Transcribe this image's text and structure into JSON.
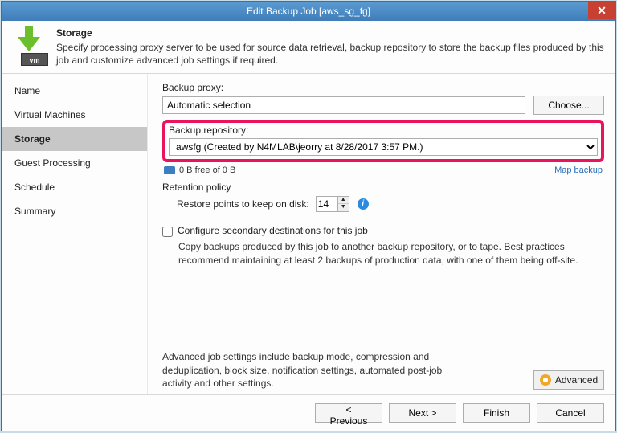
{
  "window": {
    "title": "Edit Backup Job [aws_sg_fg]"
  },
  "header": {
    "icon_text": "vm",
    "title": "Storage",
    "desc": "Specify processing proxy server to be used for source data retrieval, backup repository to store the backup files produced by this job and customize advanced job settings if required."
  },
  "sidebar": {
    "items": [
      {
        "label": "Name"
      },
      {
        "label": "Virtual Machines"
      },
      {
        "label": "Storage"
      },
      {
        "label": "Guest Processing"
      },
      {
        "label": "Schedule"
      },
      {
        "label": "Summary"
      }
    ],
    "selected_index": 2
  },
  "main": {
    "backup_proxy_label": "Backup proxy:",
    "backup_proxy_value": "Automatic selection",
    "choose_label": "Choose...",
    "backup_repo_label": "Backup repository:",
    "backup_repo_value": "awsfg (Created by N4MLAB\\jeorry at 8/28/2017 3:57 PM.)",
    "freespace_text": "0 B free of 0 B",
    "map_backup_label": "Map backup",
    "retention_label": "Retention policy",
    "restore_points_label": "Restore points to keep on disk:",
    "restore_points_value": "14",
    "secondary_check_label": "Configure secondary destinations for this job",
    "secondary_desc": "Copy backups produced by this job to another backup repository, or to tape. Best practices recommend maintaining at least 2 backups of production data, with one of them being off-site.",
    "advanced_desc": "Advanced job settings include backup mode, compression and deduplication, block size, notification settings, automated post-job activity and other settings.",
    "advanced_button": "Advanced"
  },
  "footer": {
    "previous": "< Previous",
    "next": "Next >",
    "finish": "Finish",
    "cancel": "Cancel"
  }
}
